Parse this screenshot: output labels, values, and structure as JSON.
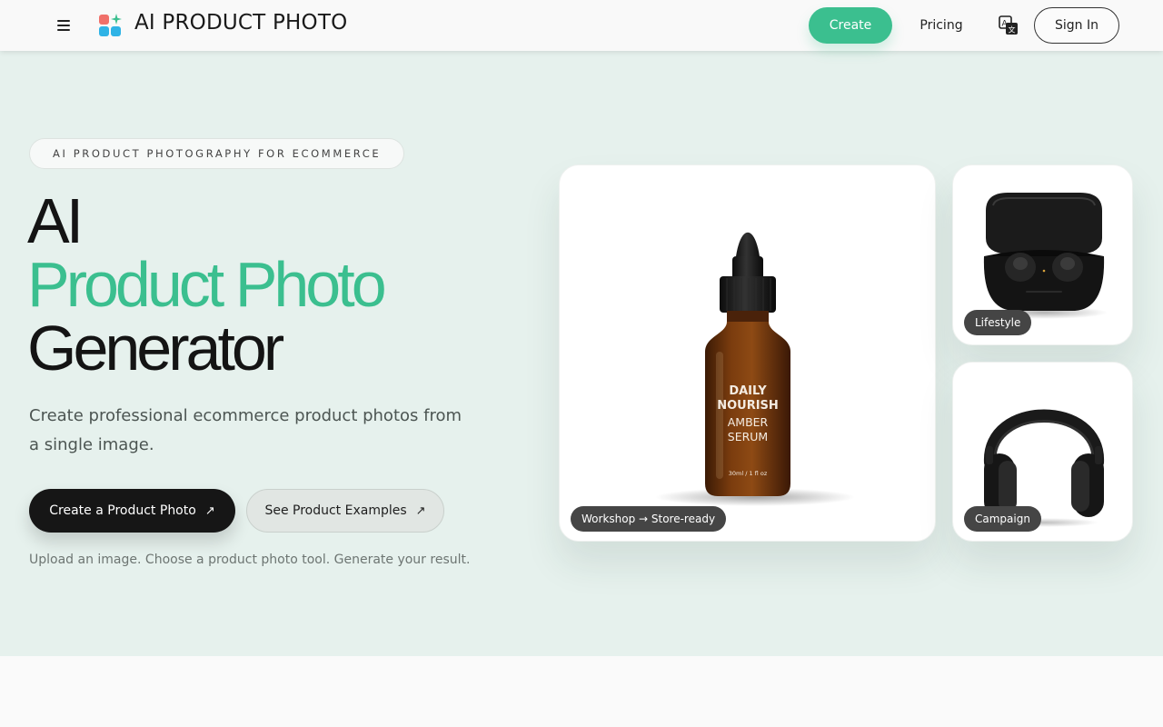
{
  "header": {
    "brand": "AI PRODUCT PHOTO",
    "nav_create": "Create",
    "nav_pricing": "Pricing",
    "nav_signin": "Sign In",
    "menu_icon": "hamburger-icon",
    "language_icon": "translate-icon"
  },
  "hero": {
    "eyebrow": "AI PRODUCT PHOTOGRAPHY FOR ECOMMERCE",
    "title_line1": "AI",
    "title_line2": "Product Photo",
    "title_line3": "Generator",
    "subtitle": "Create professional ecommerce product photos from a single image.",
    "cta_primary": "Create a Product Photo",
    "cta_secondary": "See Product Examples",
    "cta_arrow": "↗",
    "helper": "Upload an image. Choose a product photo tool. Generate your result."
  },
  "gallery": {
    "main_label": "Workshop → Store-ready",
    "top_label": "Lifestyle",
    "bottom_label": "Campaign",
    "bottle_text_1": "DAILY",
    "bottle_text_2": "NOURISH",
    "bottle_text_3": "AMBER",
    "bottle_text_4": "SERUM",
    "bottle_text_5": "30ml / 1 fl oz"
  },
  "colors": {
    "accent": "#3bbf8f",
    "hero_bg": "#e6f1ed",
    "dark": "#161616"
  }
}
